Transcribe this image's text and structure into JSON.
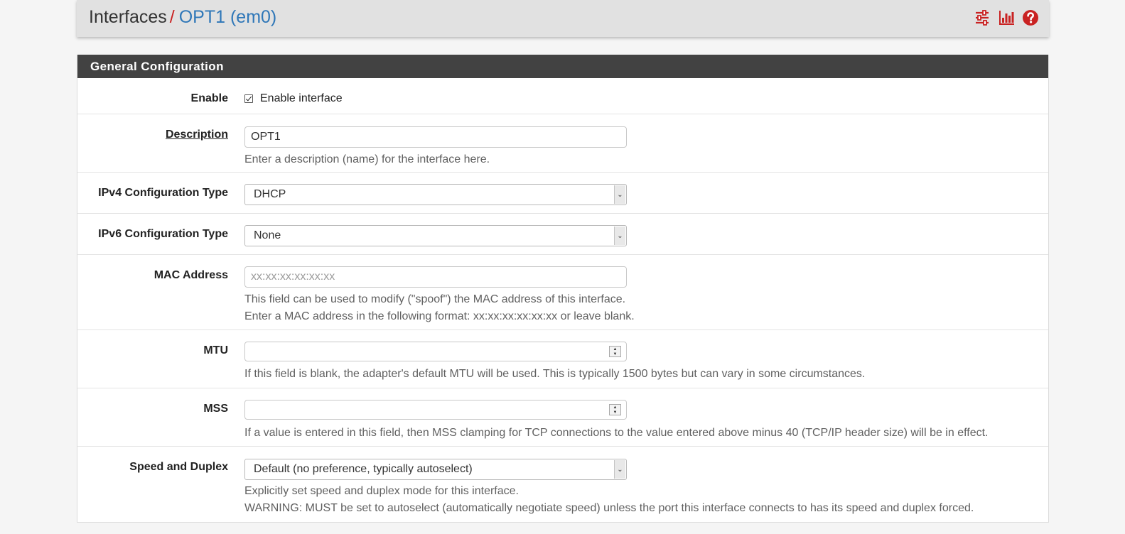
{
  "breadcrumb": {
    "root": "Interfaces",
    "separator": "/",
    "current": "OPT1 (em0)"
  },
  "header_icons": [
    "sliders-icon",
    "bar-chart-icon",
    "help-icon"
  ],
  "colors": {
    "accent_red": "#c92222",
    "link_blue": "#2f77b8",
    "panel_heading_bg": "#424242"
  },
  "panel": {
    "title": "General Configuration"
  },
  "form": {
    "enable": {
      "label": "Enable",
      "checkbox_label": "Enable interface",
      "checked": true
    },
    "description": {
      "label": "Description",
      "value": "OPT1",
      "help": "Enter a description (name) for the interface here."
    },
    "ipv4_type": {
      "label": "IPv4 Configuration Type",
      "selected": "DHCP"
    },
    "ipv6_type": {
      "label": "IPv6 Configuration Type",
      "selected": "None"
    },
    "mac": {
      "label": "MAC Address",
      "value": "",
      "placeholder": "xx:xx:xx:xx:xx:xx",
      "help1": "This field can be used to modify (\"spoof\") the MAC address of this interface.",
      "help2": "Enter a MAC address in the following format: xx:xx:xx:xx:xx:xx or leave blank."
    },
    "mtu": {
      "label": "MTU",
      "value": "",
      "help": "If this field is blank, the adapter's default MTU will be used. This is typically 1500 bytes but can vary in some circumstances."
    },
    "mss": {
      "label": "MSS",
      "value": "",
      "help": "If a value is entered in this field, then MSS clamping for TCP connections to the value entered above minus 40 (TCP/IP header size) will be in effect."
    },
    "speed_duplex": {
      "label": "Speed and Duplex",
      "selected": "Default (no preference, typically autoselect)",
      "help1": "Explicitly set speed and duplex mode for this interface.",
      "help2": "WARNING: MUST be set to autoselect (automatically negotiate speed) unless the port this interface connects to has its speed and duplex forced."
    }
  }
}
